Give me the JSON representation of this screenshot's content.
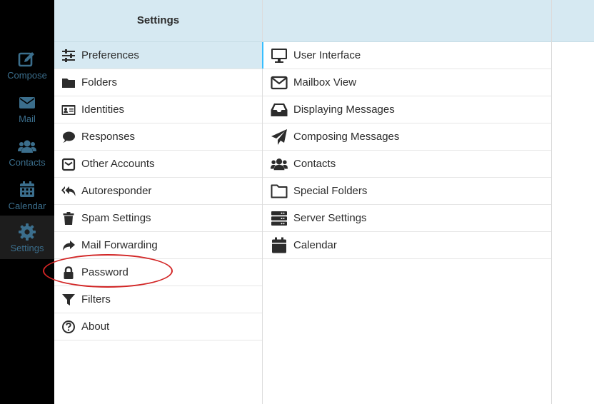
{
  "nav": {
    "items": [
      {
        "label": "Compose",
        "icon": "compose-icon"
      },
      {
        "label": "Mail",
        "icon": "envelope-icon"
      },
      {
        "label": "Contacts",
        "icon": "users-icon"
      },
      {
        "label": "Calendar",
        "icon": "calendar-icon"
      },
      {
        "label": "Settings",
        "icon": "gear-icon",
        "active": true
      }
    ]
  },
  "sections": {
    "title": "Settings",
    "items": [
      {
        "label": "Preferences",
        "icon": "sliders-icon",
        "selected": true
      },
      {
        "label": "Folders",
        "icon": "folder-icon"
      },
      {
        "label": "Identities",
        "icon": "id-card-icon"
      },
      {
        "label": "Responses",
        "icon": "speech-bubble-icon"
      },
      {
        "label": "Other Accounts",
        "icon": "envelope-square-icon"
      },
      {
        "label": "Autoresponder",
        "icon": "reply-all-icon"
      },
      {
        "label": "Spam Settings",
        "icon": "trash-icon"
      },
      {
        "label": "Mail Forwarding",
        "icon": "share-arrow-icon"
      },
      {
        "label": "Password",
        "icon": "lock-icon"
      },
      {
        "label": "Filters",
        "icon": "filter-icon"
      },
      {
        "label": "About",
        "icon": "question-circle-icon"
      }
    ]
  },
  "preferences": {
    "items": [
      {
        "label": "User Interface",
        "icon": "monitor-icon"
      },
      {
        "label": "Mailbox View",
        "icon": "envelope-outline-icon"
      },
      {
        "label": "Displaying Messages",
        "icon": "inbox-icon"
      },
      {
        "label": "Composing Messages",
        "icon": "paper-plane-icon"
      },
      {
        "label": "Contacts",
        "icon": "users-icon"
      },
      {
        "label": "Special Folders",
        "icon": "folder-outline-icon"
      },
      {
        "label": "Server Settings",
        "icon": "server-icon"
      },
      {
        "label": "Calendar",
        "icon": "calendar-icon"
      }
    ]
  },
  "colors": {
    "accent": "#37beff",
    "header_bg": "#d6e9f2",
    "nav_bg": "#000000",
    "nav_text": "#3b6e8c",
    "annotation": "#d22525"
  }
}
